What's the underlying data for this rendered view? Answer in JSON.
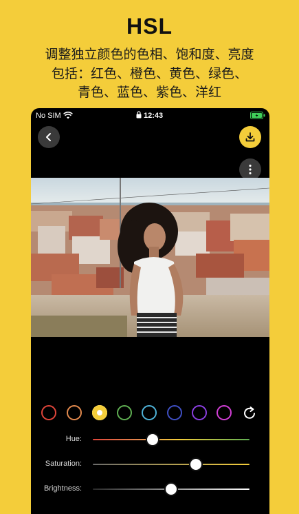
{
  "promo": {
    "headline": "HSL",
    "desc_line1": "调整独立颜色的色相、饱和度、亮度",
    "desc_line2": "包括：红色、橙色、黄色、绿色、",
    "desc_line3": "青色、蓝色、紫色、洋红"
  },
  "status_bar": {
    "carrier": "No SIM",
    "time": "12:43"
  },
  "toolbar": {
    "back_icon": "chevron-left-icon",
    "download_icon": "download-icon",
    "more_icon": "more-vertical-icon"
  },
  "color_swatches": [
    {
      "name": "red",
      "color": "#E0453A",
      "selected": false
    },
    {
      "name": "orange",
      "color": "#E38A4E",
      "selected": false
    },
    {
      "name": "yellow",
      "color": "#F4CD3A",
      "selected": true
    },
    {
      "name": "green",
      "color": "#5FAE52",
      "selected": false
    },
    {
      "name": "cyan",
      "color": "#4FB3D9",
      "selected": false
    },
    {
      "name": "blue",
      "color": "#3F4FC2",
      "selected": false
    },
    {
      "name": "purple",
      "color": "#8A3FE0",
      "selected": false
    },
    {
      "name": "magenta",
      "color": "#D23FD6",
      "selected": false
    }
  ],
  "sliders": [
    {
      "label": "Hue:",
      "value": 0.38,
      "track": "hue"
    },
    {
      "label": "Saturation:",
      "value": 0.66,
      "track": "saturation"
    },
    {
      "label": "Brightness:",
      "value": 0.5,
      "track": "brightness"
    }
  ],
  "colors": {
    "accent": "#F4CD3A",
    "background": "#000000"
  }
}
